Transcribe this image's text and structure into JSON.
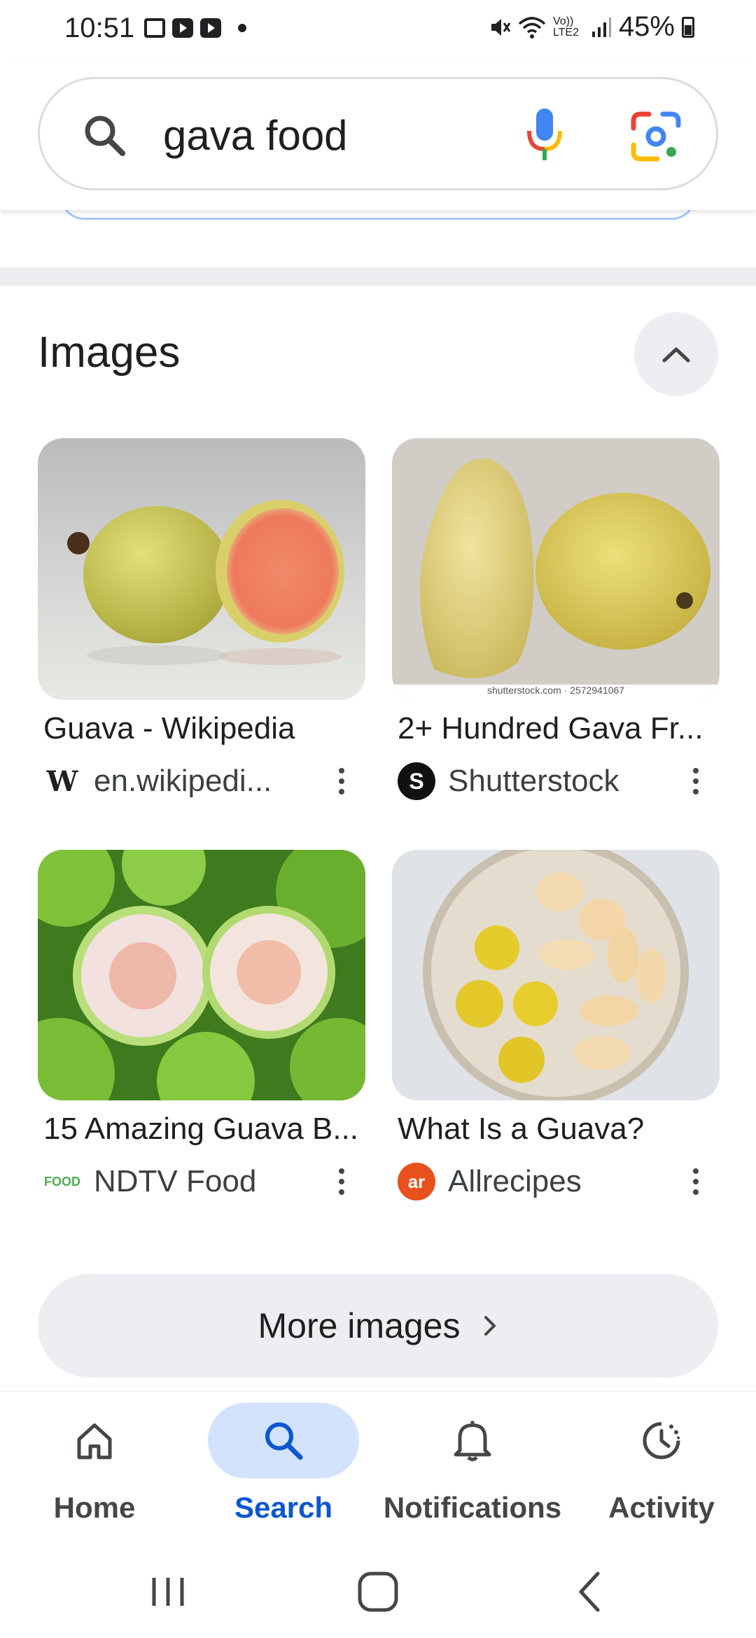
{
  "status_bar": {
    "time": "10:51",
    "battery_percent": "45%",
    "network_label": "Vo)) LTE2"
  },
  "search": {
    "query": "gava food"
  },
  "images_section": {
    "title": "Images",
    "results": [
      {
        "title": "Guava - Wikipedia",
        "source": "en.wikipedi...",
        "source_icon": "wikipedia-logo"
      },
      {
        "title": "2+ Hundred Gava Fr...",
        "source": "Shutterstock",
        "source_icon": "shutterstock-logo",
        "watermark": "shutterstock.com · 2572941067"
      },
      {
        "title": "15 Amazing Guava B...",
        "source": "NDTV Food",
        "source_icon": "ndtv-food-logo"
      },
      {
        "title": "What Is a Guava?",
        "source": "Allrecipes",
        "source_icon": "allrecipes-logo"
      }
    ],
    "more_label": "More images"
  },
  "bottom_nav": {
    "items": [
      {
        "label": "Home",
        "icon": "home-icon",
        "active": false
      },
      {
        "label": "Search",
        "icon": "search-icon",
        "active": true
      },
      {
        "label": "Notifications",
        "icon": "bell-icon",
        "active": false
      },
      {
        "label": "Activity",
        "icon": "activity-icon",
        "active": false
      }
    ]
  },
  "colors": {
    "accent": "#0b57d0",
    "active_pill": "#d3e3fd",
    "chip_bg": "#eceef1"
  }
}
